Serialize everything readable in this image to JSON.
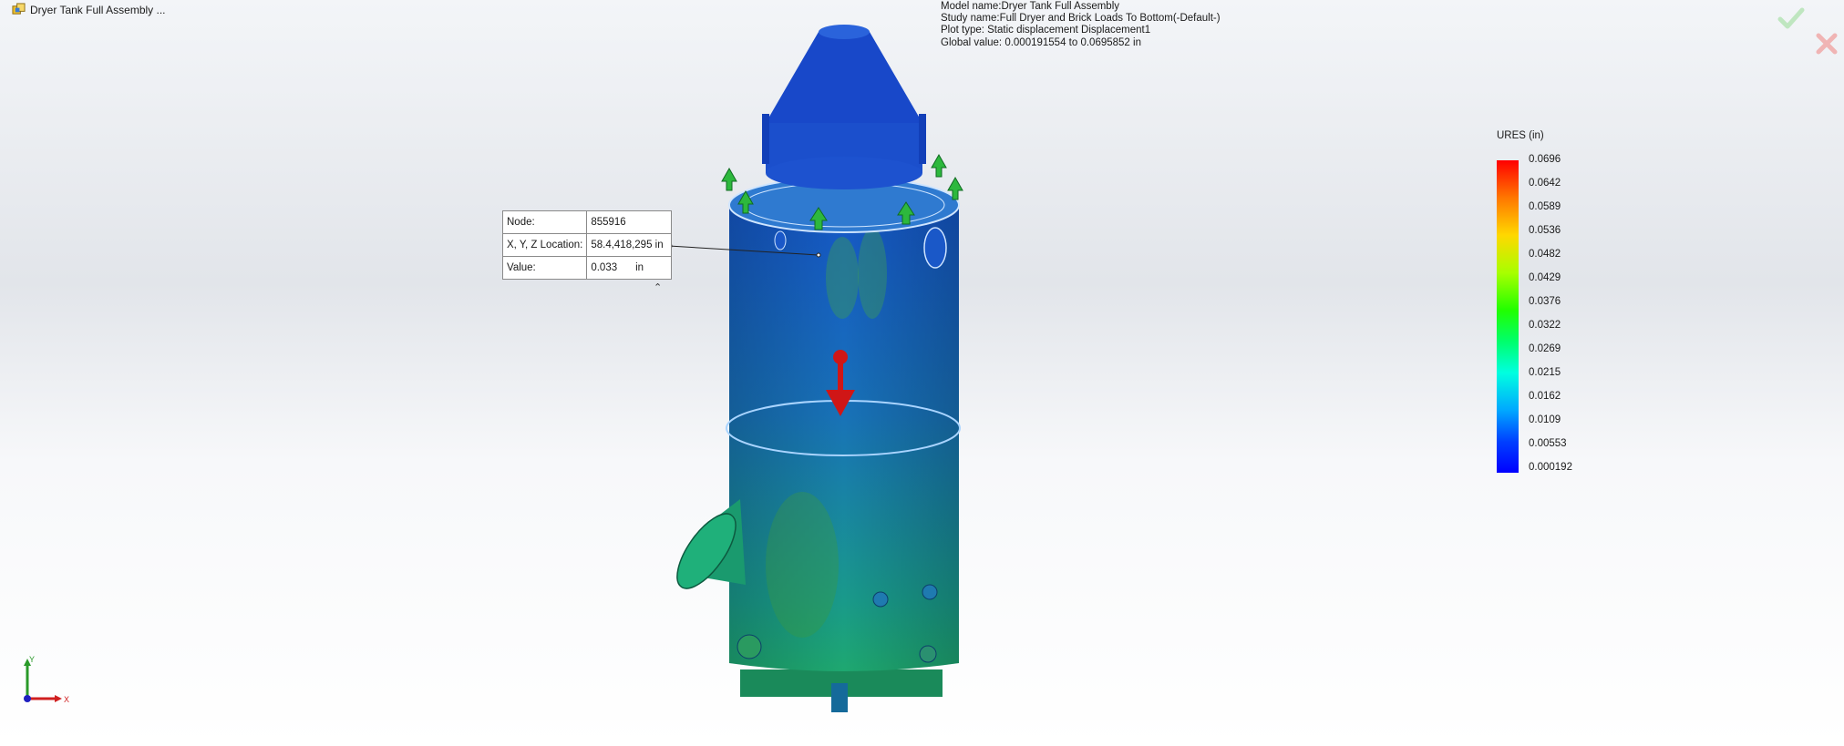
{
  "document_tab": {
    "title": "Dryer Tank Full Assembly ...",
    "icon": "assembly-icon"
  },
  "study_info": {
    "model_name": "Model name:Dryer Tank Full Assembly",
    "study_name": "Study name:Full Dryer and Brick Loads To Bottom(-Default-)",
    "plot_type": "Plot type: Static displacement Displacement1",
    "global_value": "Global value: 0.000191554 to 0.0695852 in"
  },
  "probe": {
    "node_label": "Node:",
    "node_value": "855916",
    "location_label": "X, Y, Z Location:",
    "location_value": "58.4,418,295 in",
    "value_label": "Value:",
    "value_value": "0.033",
    "value_unit": "in",
    "collapse_icon": "chevron-up-icon"
  },
  "legend": {
    "title": "URES (in)",
    "labels": [
      "0.0696",
      "0.0642",
      "0.0589",
      "0.0536",
      "0.0482",
      "0.0429",
      "0.0376",
      "0.0322",
      "0.0269",
      "0.0215",
      "0.0162",
      "0.0109",
      "0.00553",
      "0.000192"
    ]
  },
  "triad": {
    "y_label": "Y",
    "x_label": "X"
  },
  "buttons": {
    "confirm_icon": "checkmark-icon",
    "cancel_icon": "close-icon"
  },
  "colors": {
    "legend_max": "#ff0000",
    "legend_mid": "#21ff00",
    "legend_min": "#0000ff",
    "fixture": "#2db83d",
    "load": "#d01616"
  }
}
